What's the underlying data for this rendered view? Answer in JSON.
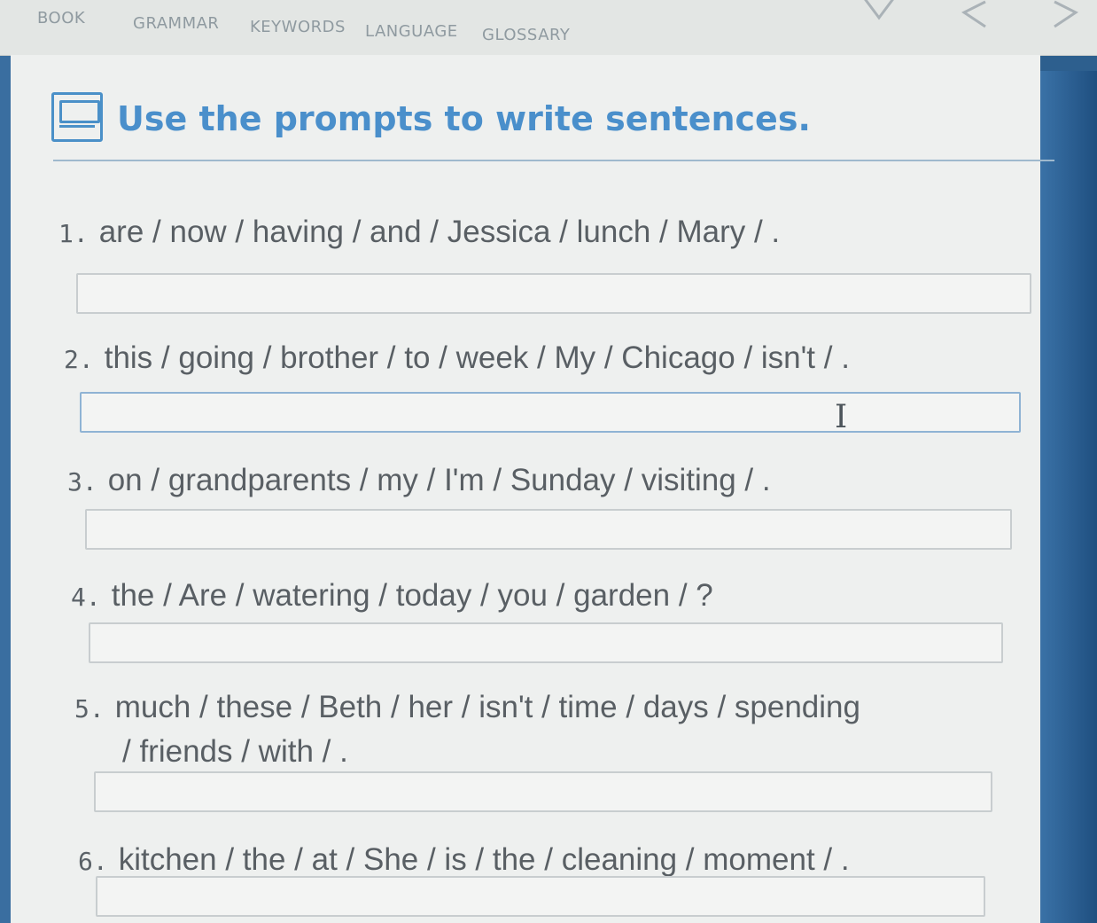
{
  "nav": {
    "items": [
      "BOOK",
      "GRAMMAR",
      "KEYWORDS",
      "LANGUAGE",
      "GLOSSARY"
    ]
  },
  "icons": [
    "bookmark-icon",
    "chevron-left-icon",
    "chevron-right-icon",
    "text-cursor-icon",
    "exercise-icon"
  ],
  "colors": {
    "accent": "#4a8fcb",
    "text": "#595f64",
    "page": "#eef0ef"
  },
  "exercise": {
    "title": "Use the prompts to write sentences.",
    "questions": [
      {
        "number": "1.",
        "prompt": "are / now / having / and / Jessica / lunch / Mary / .",
        "answer": ""
      },
      {
        "number": "2.",
        "prompt": "this / going / brother / to / week / My / Chicago / isn't / .",
        "answer": ""
      },
      {
        "number": "3.",
        "prompt": "on / grandparents / my / I'm / Sunday / visiting / .",
        "answer": ""
      },
      {
        "number": "4.",
        "prompt": "the / Are / watering / today / you / garden / ?",
        "answer": ""
      },
      {
        "number": "5.",
        "prompt": "much / these / Beth / her / isn't / time / days / spending",
        "prompt_cont": "/ friends / with / .",
        "answer": ""
      },
      {
        "number": "6.",
        "prompt": "kitchen / the / at / She / is / the / cleaning / moment / .",
        "answer": ""
      }
    ]
  }
}
